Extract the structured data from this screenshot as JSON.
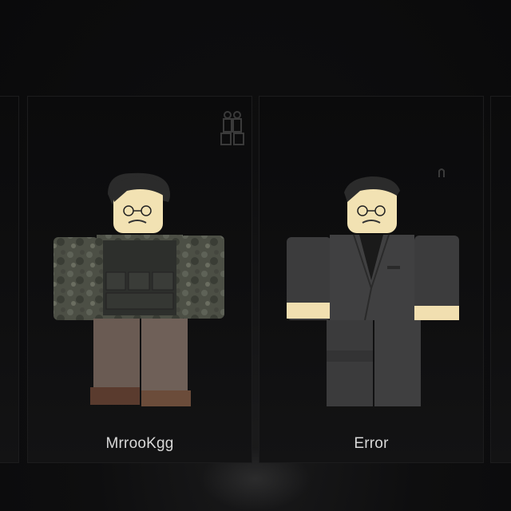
{
  "cards": [
    {
      "username": "MrrooKgg",
      "outfit": "camo-tactical",
      "badge_icon": "soldiers-icon"
    },
    {
      "username": "Error",
      "outfit": "black-suit",
      "badge_icon": "small-figure-icon"
    }
  ],
  "colors": {
    "background": "#0d0d0e",
    "card_background": "#0e0e0f",
    "label_text": "#d8d8d8",
    "skin": "#f3e3b4",
    "hair": "#2a2a2a"
  }
}
